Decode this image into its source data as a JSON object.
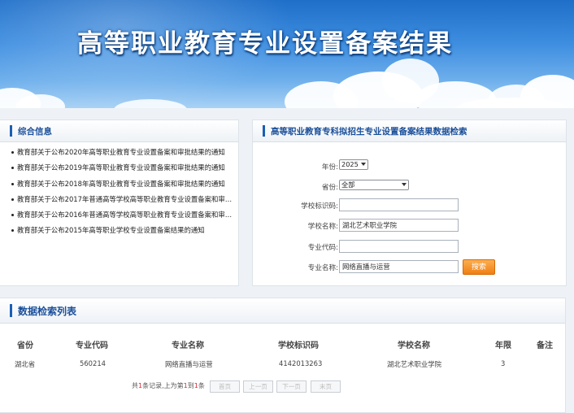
{
  "banner": {
    "title": "高等职业教育专业设置备案结果"
  },
  "news_panel": {
    "title": "综合信息",
    "items": [
      "教育部关于公布2020年高等职业教育专业设置备案和审批结果的通知",
      "教育部关于公布2019年高等职业教育专业设置备案和审批结果的通知",
      "教育部关于公布2018年高等职业教育专业设置备案和审批结果的通知",
      "教育部关于公布2017年普通高等学校高等职业教育专业设置备案和审…",
      "教育部关于公布2016年普通高等学校高等职业教育专业设置备案和审…",
      "教育部关于公布2015年高等职业学校专业设置备案结果的通知"
    ]
  },
  "search_panel": {
    "title": "高等职业教育专科拟招生专业设置备案结果数据检索",
    "year_label": "年份:",
    "year_value": "2025",
    "province_label": "省份:",
    "province_value": "全部",
    "school_code_label": "学校标识码:",
    "school_code_value": "",
    "school_name_label": "学校名称:",
    "school_name_value": "湖北艺术职业学院",
    "major_code_label": "专业代码:",
    "major_code_value": "",
    "major_name_label": "专业名称:",
    "major_name_value": "网络直播与运营",
    "search_button": "搜索"
  },
  "results": {
    "title": "数据检索列表",
    "columns": [
      "省份",
      "专业代码",
      "专业名称",
      "学校标识码",
      "学校名称",
      "年限",
      "备注"
    ],
    "rows": [
      [
        "湖北省",
        "560214",
        "网络直播与运营",
        "4142013263",
        "湖北艺术职业学院",
        "3",
        ""
      ]
    ],
    "pager": {
      "prefix": "共",
      "total": "1",
      "mid": "条记录,上为第",
      "from": "1",
      "to_word": "到",
      "to": "1",
      "suffix": "条",
      "buttons": [
        "首页",
        "上一页",
        "下一页",
        "末页"
      ]
    }
  }
}
